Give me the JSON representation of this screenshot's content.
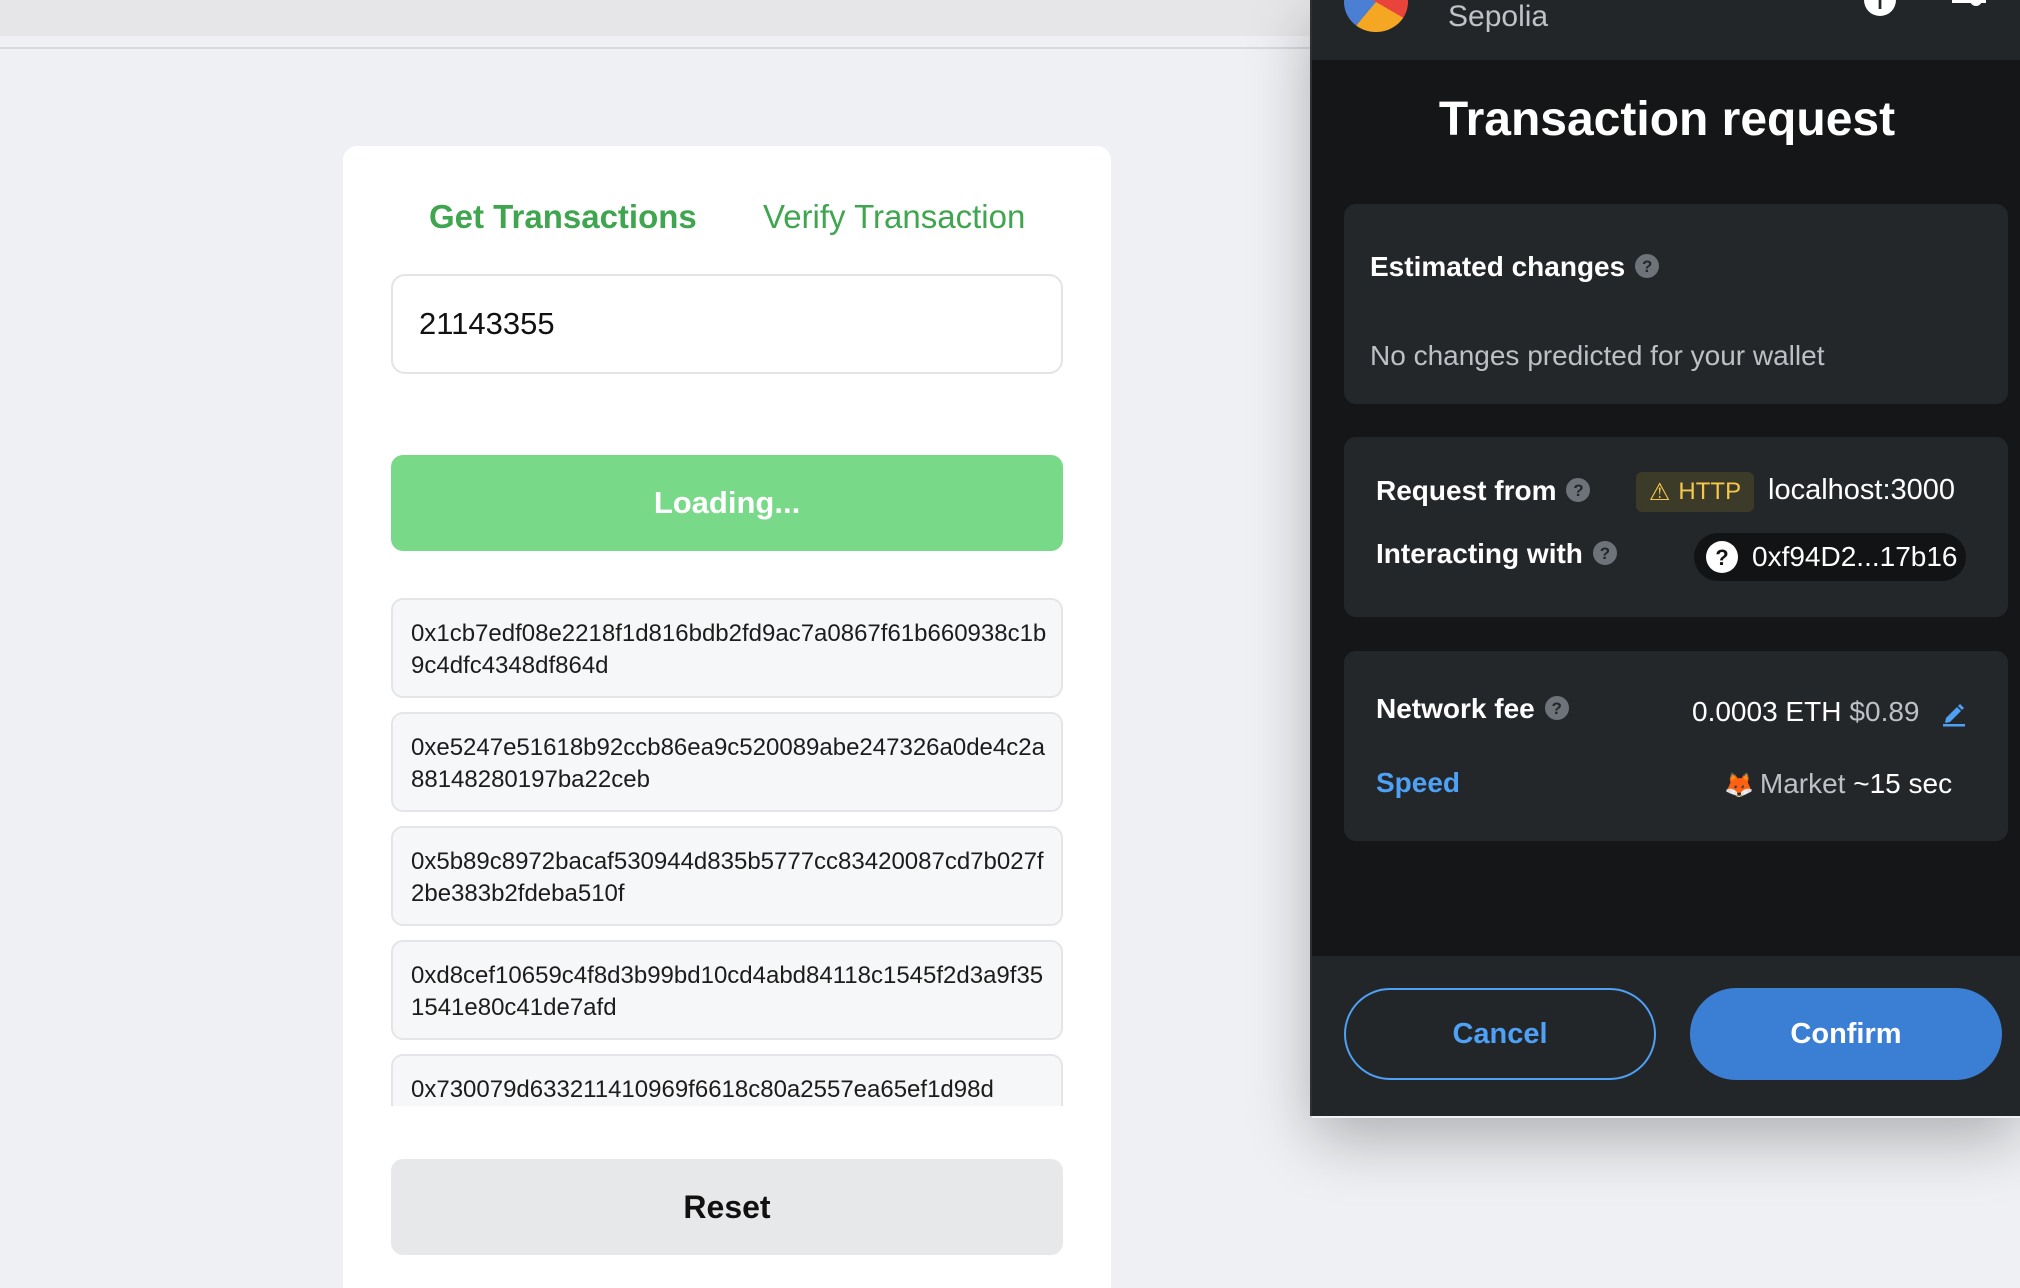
{
  "app": {
    "tabs": [
      {
        "label": "Get Transactions",
        "active": true
      },
      {
        "label": "Verify Transaction",
        "active": false
      }
    ],
    "input_value": "21143355",
    "loading_label": "Loading...",
    "transactions": [
      "0x1cb7edf08e2218f1d816bdb2fd9ac7a0867f61b660938c1b9c4dfc4348df864d",
      "0xe5247e51618b92ccb86ea9c520089abe247326a0de4c2a88148280197ba22ceb",
      "0x5b89c8972bacaf530944d835b5777cc83420087cd7b027f2be383b2fdeba510f",
      "0xd8cef10659c4f8d3b99bd10cd4abd84118c1545f2d3a9f351541e80c41de7afd",
      "0x730079d633211410969f6618c80a2557ea65ef1d98d"
    ],
    "reset_label": "Reset",
    "accent_color": "#3fa64f"
  },
  "wallet": {
    "network": "Sepolia",
    "title": "Transaction request",
    "estimated_changes": {
      "label": "Estimated changes",
      "message": "No changes predicted for your wallet"
    },
    "request_from": {
      "label": "Request from",
      "badge": "HTTP",
      "origin": "localhost:3000"
    },
    "interacting_with": {
      "label": "Interacting with",
      "address": "0xf94D2...17b16"
    },
    "network_fee": {
      "label": "Network fee",
      "eth": "0.0003 ETH",
      "usd": "$0.89"
    },
    "speed": {
      "label": "Speed",
      "value": "Market",
      "time": "~15 sec"
    },
    "cancel_label": "Cancel",
    "confirm_label": "Confirm",
    "confirm_color": "#3b7fd4",
    "icons": [
      "network-logo-icon",
      "info-icon",
      "settings-icon",
      "help-icon",
      "warning-icon",
      "unknown-contract-icon",
      "edit-pencil-icon",
      "fox-icon"
    ]
  }
}
